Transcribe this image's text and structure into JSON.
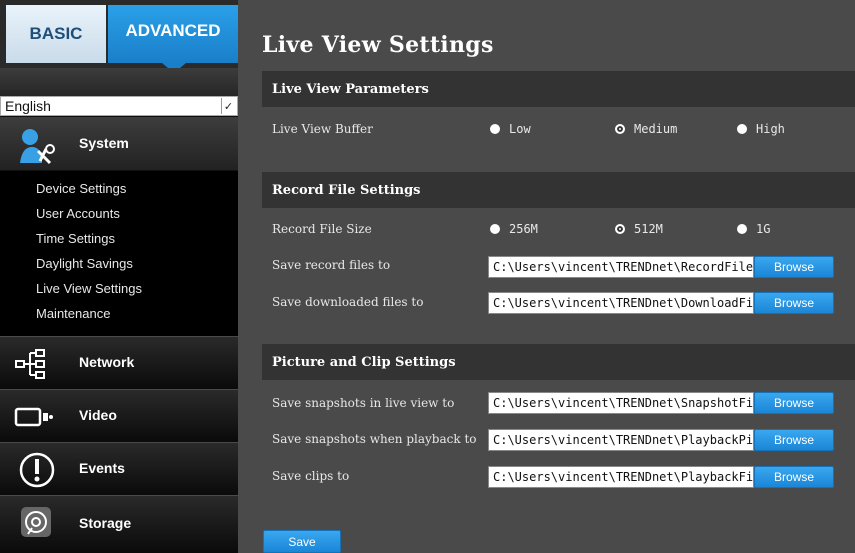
{
  "tabs": {
    "basic": "BASIC",
    "advanced": "ADVANCED"
  },
  "language": {
    "selected": "English"
  },
  "nav": {
    "system": "System",
    "network": "Network",
    "video": "Video",
    "events": "Events",
    "storage": "Storage"
  },
  "submenu": [
    "Device Settings",
    "User Accounts",
    "Time Settings",
    "Daylight Savings",
    "Live View Settings",
    "Maintenance"
  ],
  "page": {
    "title": "Live View Settings"
  },
  "live_view": {
    "header": "Live View Parameters",
    "buffer_label": "Live View Buffer",
    "options": [
      "Low",
      "Medium",
      "High"
    ],
    "selected": "Medium"
  },
  "record": {
    "header": "Record File Settings",
    "size_label": "Record File Size",
    "size_options": [
      "256M",
      "512M",
      "1G"
    ],
    "size_selected": "512M",
    "save_record_label": "Save record files to",
    "save_record_value": "C:\\Users\\vincent\\TRENDnet\\RecordFiles",
    "save_download_label": "Save downloaded files to",
    "save_download_value": "C:\\Users\\vincent\\TRENDnet\\DownloadFiles"
  },
  "picture": {
    "header": "Picture and Clip Settings",
    "snap_live_label": "Save snapshots in live view to",
    "snap_live_value": "C:\\Users\\vincent\\TRENDnet\\SnapshotFiles",
    "snap_play_label": "Save snapshots when playback to",
    "snap_play_value": "C:\\Users\\vincent\\TRENDnet\\PlaybackPics",
    "clips_label": "Save clips to",
    "clips_value": "C:\\Users\\vincent\\TRENDnet\\PlaybackFiles"
  },
  "buttons": {
    "browse": "Browse",
    "save": "Save"
  },
  "colors": {
    "accent": "#1a86d6",
    "background": "#4a4a4a",
    "section": "#333333"
  }
}
